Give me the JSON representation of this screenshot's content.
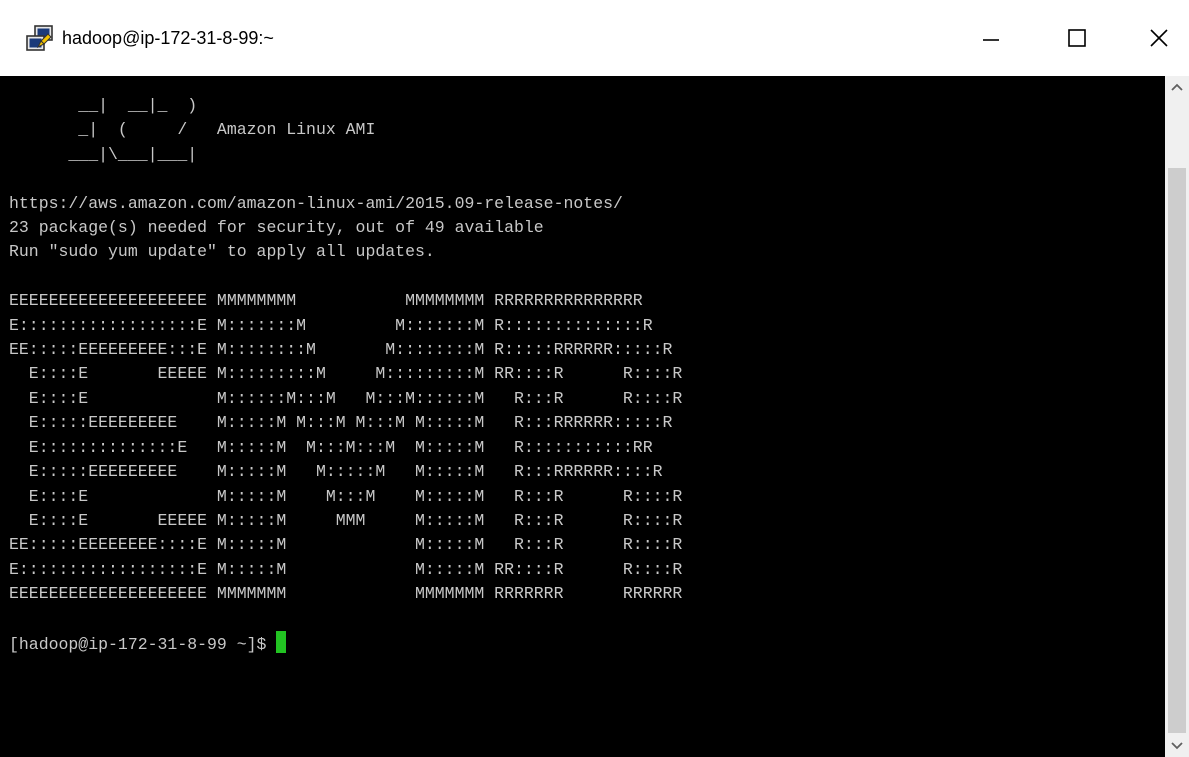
{
  "window": {
    "title": "hadoop@ip-172-31-8-99:~",
    "icon": "putty-terminal-icon",
    "controls": [
      "minimize-icon",
      "maximize-icon",
      "close-icon"
    ]
  },
  "terminal": {
    "lines": [
      "       __|  __|_  )",
      "       _|  (     /   Amazon Linux AMI",
      "      ___|\\___|___|",
      "",
      "https://aws.amazon.com/amazon-linux-ami/2015.09-release-notes/",
      "23 package(s) needed for security, out of 49 available",
      "Run \"sudo yum update\" to apply all updates.",
      "",
      "EEEEEEEEEEEEEEEEEEEE MMMMMMMM           MMMMMMMM RRRRRRRRRRRRRRR",
      "E::::::::::::::::::E M:::::::M         M:::::::M R::::::::::::::R",
      "EE:::::EEEEEEEEE:::E M::::::::M       M::::::::M R:::::RRRRRR:::::R",
      "  E::::E       EEEEE M:::::::::M     M:::::::::M RR::::R      R::::R",
      "  E::::E             M::::::M:::M   M:::M::::::M   R:::R      R::::R",
      "  E:::::EEEEEEEEE    M:::::M M:::M M:::M M:::::M   R:::RRRRRR:::::R",
      "  E::::::::::::::E   M:::::M  M:::M:::M  M:::::M   R:::::::::::RR",
      "  E:::::EEEEEEEEE    M:::::M   M:::::M   M:::::M   R:::RRRRRR::::R",
      "  E::::E             M:::::M    M:::M    M:::::M   R:::R      R::::R",
      "  E::::E       EEEEE M:::::M     MMM     M:::::M   R:::R      R::::R",
      "EE:::::EEEEEEEE::::E M:::::M             M:::::M   R:::R      R::::R",
      "E::::::::::::::::::E M:::::M             M:::::M RR::::R      R::::R",
      "EEEEEEEEEEEEEEEEEEEE MMMMMMM             MMMMMMM RRRRRRR      RRRRRR",
      ""
    ],
    "prompt": "[hadoop@ip-172-31-8-99 ~]$ ",
    "colors": {
      "background": "#000000",
      "foreground": "#c8c8c8",
      "cursor": "#22c322"
    }
  },
  "scrollbar": {
    "up_icon": "scroll-up-arrow-icon",
    "down_icon": "scroll-down-arrow-icon"
  }
}
